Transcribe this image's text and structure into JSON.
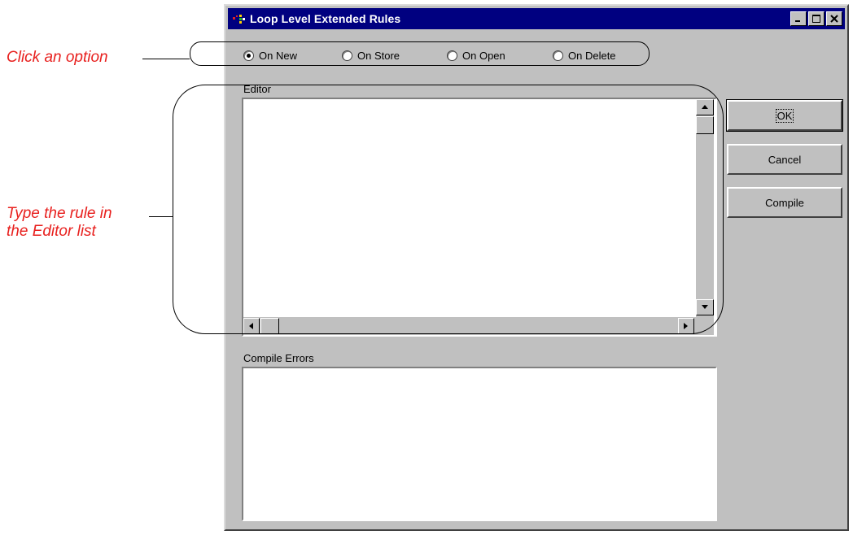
{
  "annotations": {
    "click_option": "Click an option",
    "type_rule_line1": "Type the rule in",
    "type_rule_line2": "the Editor list"
  },
  "window": {
    "title": "Loop Level Extended Rules",
    "icon": "app-icon",
    "controls": [
      "minimize-icon",
      "maximize-icon",
      "close-icon"
    ]
  },
  "options": [
    {
      "label": "On New",
      "selected": true
    },
    {
      "label": "On Store",
      "selected": false
    },
    {
      "label": "On Open",
      "selected": false
    },
    {
      "label": "On Delete",
      "selected": false
    }
  ],
  "editor": {
    "label": "Editor",
    "value": ""
  },
  "compile_errors": {
    "label": "Compile Errors",
    "value": ""
  },
  "buttons": {
    "ok": "OK",
    "cancel": "Cancel",
    "compile": "Compile"
  }
}
